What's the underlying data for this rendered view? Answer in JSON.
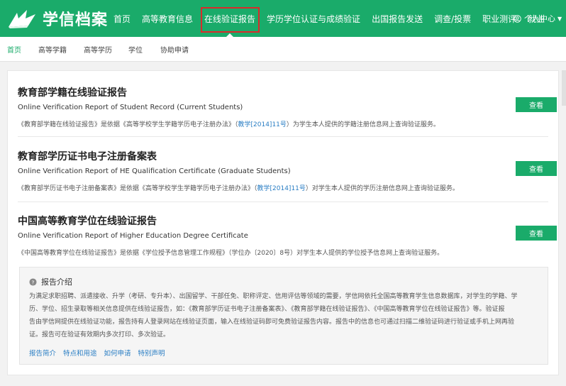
{
  "brand": {
    "name": "学信档案",
    "logo_icon": "book-logo-icon"
  },
  "nav": {
    "items": [
      {
        "label": "首页"
      },
      {
        "label": "高等教育信息"
      },
      {
        "label": "在线验证报告"
      },
      {
        "label": "学历学位认证与成绩验证"
      },
      {
        "label": "出国报告发送"
      },
      {
        "label": "调查/投票"
      },
      {
        "label": "职业测评"
      },
      {
        "label": "就业"
      }
    ],
    "user_label": "个人中心",
    "user_icon": "user-circle-icon",
    "dropdown_icon": "caret-down-icon"
  },
  "subnav": {
    "items": [
      {
        "label": "首页"
      },
      {
        "label": "高等学籍"
      },
      {
        "label": "高等学历"
      },
      {
        "label": "学位"
      },
      {
        "label": "协助申请"
      }
    ]
  },
  "reports": [
    {
      "title": "教育部学籍在线验证报告",
      "subtitle": "Online Verification Report of Student Record (Current Students)",
      "desc_before": "《教育部学籍在线验证报告》是依据《高等学校学生学籍学历电子注册办法》（",
      "desc_link": "教学[2014]11号",
      "desc_after": "）为学生本人提供的学籍注册信息网上查询验证服务。",
      "button": "查看"
    },
    {
      "title": "教育部学历证书电子注册备案表",
      "subtitle": "Online Verification Report of HE Qualification Certificate (Graduate Students)",
      "desc_before": "《教育部学历证书电子注册备案表》是依据《高等学校学生学籍学历电子注册办法》（",
      "desc_link": "教学[2014]11号",
      "desc_after": "）对学生本人提供的学历注册信息网上查询验证服务。",
      "button": "查看"
    },
    {
      "title": "中国高等教育学位在线验证报告",
      "subtitle": "Online Verification Report of Higher Education Degree Certificate",
      "desc_before": "《中国高等教育学位在线验证报告》是依据《学位授予信息管理工作规程》（学位办〔2020〕8号）对学生本人提供的学位授予信息网上查询验证服务。",
      "desc_link": "",
      "desc_after": "",
      "button": "查看"
    }
  ],
  "intro": {
    "title": "报告介绍",
    "icon": "question-circle-icon",
    "lines": [
      "为满足求职招聘、派遣接收、升学（考研、专升本）、出国留学、干部任免、职称评定、信用评估等领域的需要，学信网依托全国高等教育学生信息数据库，对学生的学籍、学",
      "历、学位、招生录取等相关信息提供在线验证报告，如：《教育部学历证书电子注册备案表》、《教育部学籍在线验证报告》、《中国高等教育学位在线验证报告》等。验证报",
      "告由学信网提供在线验证功能，报告持有人登录网站在线验证页面，输入在线验证码即可免费验证报告内容。报告中的信息也可通过扫描二维验证码进行验证或手机上网再验",
      "证。报告可在验证有效期内多次打印、多次验证。"
    ],
    "links": [
      "报告简介",
      "特点和用途",
      "如何申请",
      "特别声明"
    ]
  }
}
